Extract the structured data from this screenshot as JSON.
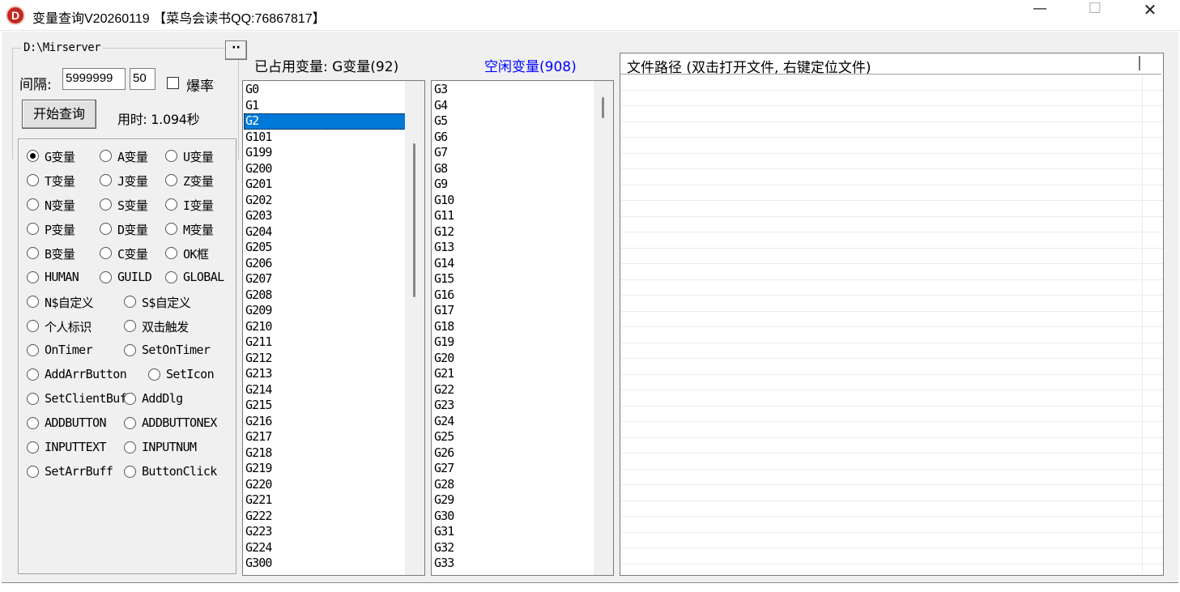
{
  "window": {
    "title": "变量查询V20260119 【菜鸟会读书QQ:76867817】",
    "icon_letter": "D",
    "minimize_glyph": "—",
    "maximize_glyph": "☐",
    "close_glyph": "✕"
  },
  "path": {
    "label": "D:\\Mirserver",
    "browse_label": "··"
  },
  "controls": {
    "interval_label": "间隔:",
    "interval_value": "5999999",
    "count_value": "50",
    "checkbox_label": "爆率",
    "checkbox_checked": false,
    "start_button": "开始查询",
    "time_label": "用时: 1.094秒"
  },
  "radios": [
    {
      "label": "G变量",
      "checked": true
    },
    {
      "label": "A变量",
      "checked": false
    },
    {
      "label": "U变量",
      "checked": false
    },
    {
      "label": "T变量",
      "checked": false
    },
    {
      "label": "J变量",
      "checked": false
    },
    {
      "label": "Z变量",
      "checked": false
    },
    {
      "label": "N变量",
      "checked": false
    },
    {
      "label": "S变量",
      "checked": false
    },
    {
      "label": "I变量",
      "checked": false
    },
    {
      "label": "P变量",
      "checked": false
    },
    {
      "label": "D变量",
      "checked": false
    },
    {
      "label": "M变量",
      "checked": false
    },
    {
      "label": "B变量",
      "checked": false
    },
    {
      "label": "C变量",
      "checked": false
    },
    {
      "label": "OK框",
      "checked": false
    },
    {
      "label": "HUMAN",
      "checked": false
    },
    {
      "label": "GUILD",
      "checked": false
    },
    {
      "label": "GLOBAL",
      "checked": false
    },
    {
      "label": "N$自定义",
      "checked": false
    },
    {
      "label": "S$自定义",
      "checked": false
    },
    {
      "label": "个人标识",
      "checked": false
    },
    {
      "label": "双击触发",
      "checked": false
    },
    {
      "label": "OnTimer",
      "checked": false
    },
    {
      "label": "SetOnTimer",
      "checked": false
    },
    {
      "label": "AddArrButton",
      "checked": false
    },
    {
      "label": "SetIcon",
      "checked": false
    },
    {
      "label": "SetClientBuff",
      "checked": false
    },
    {
      "label": "AddDlg",
      "checked": false
    },
    {
      "label": "ADDBUTTON",
      "checked": false
    },
    {
      "label": "ADDBUTTONEX",
      "checked": false
    },
    {
      "label": "INPUTTEXT",
      "checked": false
    },
    {
      "label": "INPUTNUM",
      "checked": false
    },
    {
      "label": "SetArrBuff",
      "checked": false
    },
    {
      "label": "ButtonClick",
      "checked": false
    }
  ],
  "used_list": {
    "title": "已占用变量: G变量(92)",
    "selected_index": 2,
    "scroll_position": 0.15,
    "items": [
      "G0",
      "G1",
      "G2",
      "G101",
      "G199",
      "G200",
      "G201",
      "G202",
      "G203",
      "G204",
      "G205",
      "G206",
      "G207",
      "G208",
      "G209",
      "G210",
      "G211",
      "G212",
      "G213",
      "G214",
      "G215",
      "G216",
      "G217",
      "G218",
      "G219",
      "G220",
      "G221",
      "G222",
      "G223",
      "G224",
      "G300"
    ]
  },
  "free_list": {
    "title": "空闲变量(908)",
    "title_color": "#0000ff",
    "scroll_position": 0.0,
    "items": [
      "G3",
      "G4",
      "G5",
      "G6",
      "G7",
      "G8",
      "G9",
      "G10",
      "G11",
      "G12",
      "G13",
      "G14",
      "G15",
      "G16",
      "G17",
      "G18",
      "G19",
      "G20",
      "G21",
      "G22",
      "G23",
      "G24",
      "G25",
      "G26",
      "G27",
      "G28",
      "G29",
      "G30",
      "G31",
      "G32",
      "G33"
    ]
  },
  "file_list": {
    "column_header": "文件路径 (双击打开文件, 右键定位文件)",
    "rows": []
  },
  "colors": {
    "selection": "#0078d7",
    "window_bg": "#f0f0f0"
  }
}
